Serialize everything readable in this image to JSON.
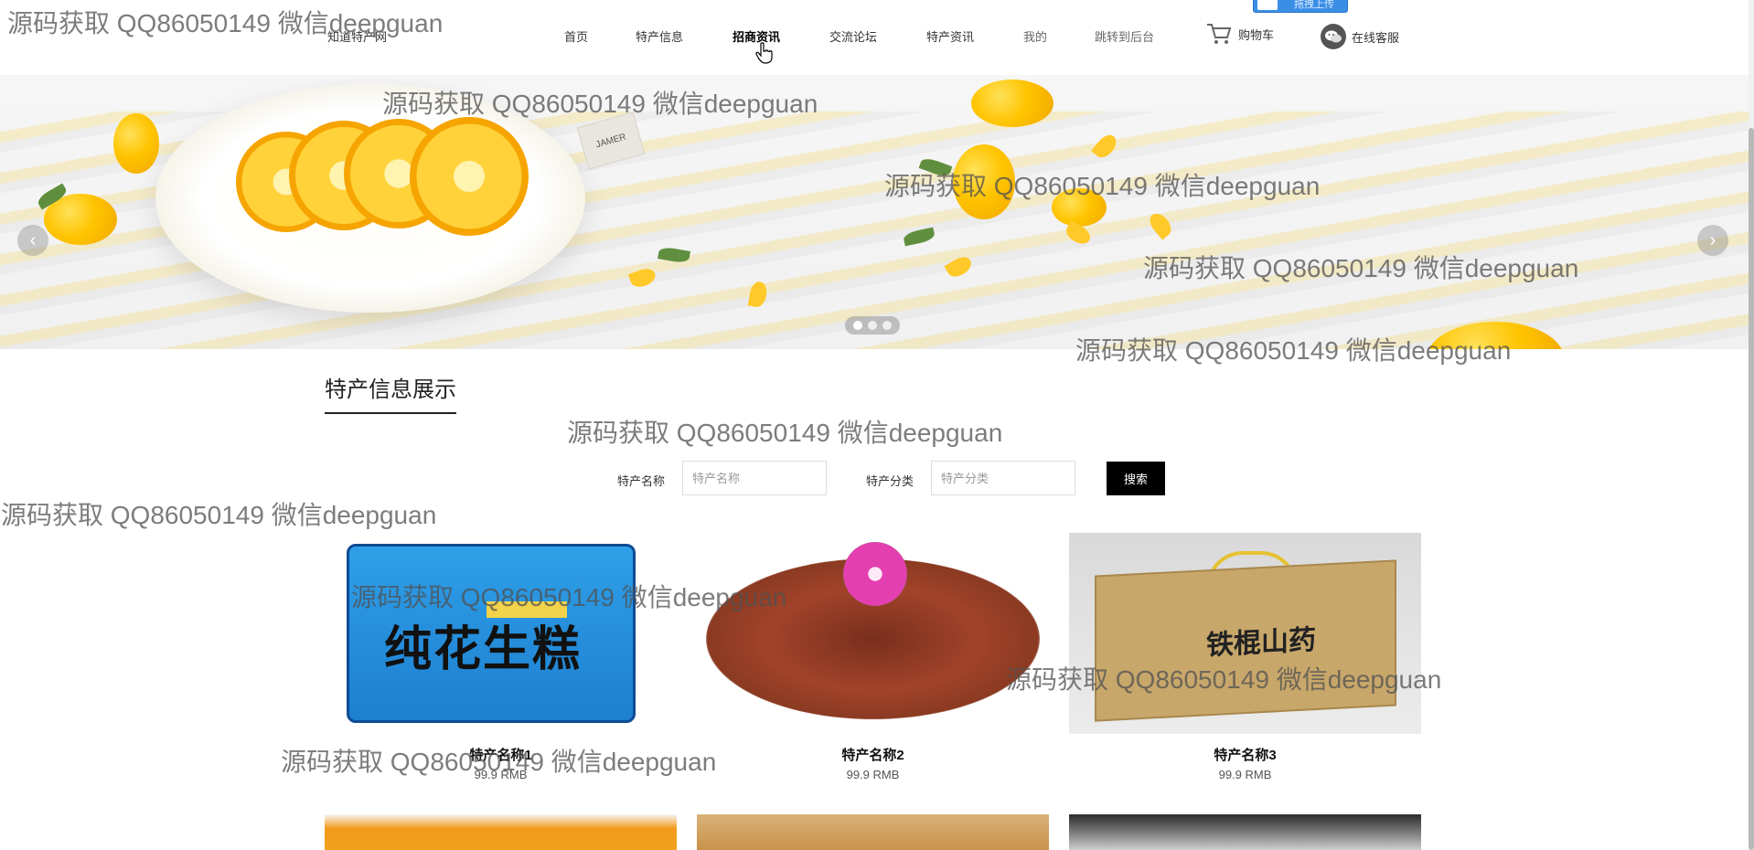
{
  "header": {
    "site_name": "知道特产网",
    "nav": [
      {
        "label": "首页"
      },
      {
        "label": "特产信息"
      },
      {
        "label": "招商资讯"
      },
      {
        "label": "交流论坛"
      },
      {
        "label": "特产资讯"
      },
      {
        "label": "我的"
      },
      {
        "label": "跳转到后台"
      }
    ],
    "active_nav": "招商资讯",
    "cart_label": "购物车",
    "service_label": "在线客服",
    "upload_label": "拖拽上传"
  },
  "banner": {
    "tag_text": "JAMER",
    "slide_count": 3,
    "active_slide": 1
  },
  "section": {
    "title": "特产信息展示"
  },
  "search": {
    "name_label": "特产名称",
    "name_placeholder": "特产名称",
    "category_label": "特产分类",
    "category_placeholder": "特产分类",
    "button_label": "搜索"
  },
  "products": [
    {
      "name": "特产名称1",
      "price": "99.9 RMB",
      "image_text": "纯花生糕"
    },
    {
      "name": "特产名称2",
      "price": "99.9 RMB"
    },
    {
      "name": "特产名称3",
      "price": "99.9 RMB",
      "image_text": "铁棍山药"
    }
  ],
  "watermark": "源码获取 QQ86050149 微信deepguan",
  "colors": {
    "accent_button": "#000000",
    "upload_button": "#3a8ee6",
    "text": "#333333"
  }
}
